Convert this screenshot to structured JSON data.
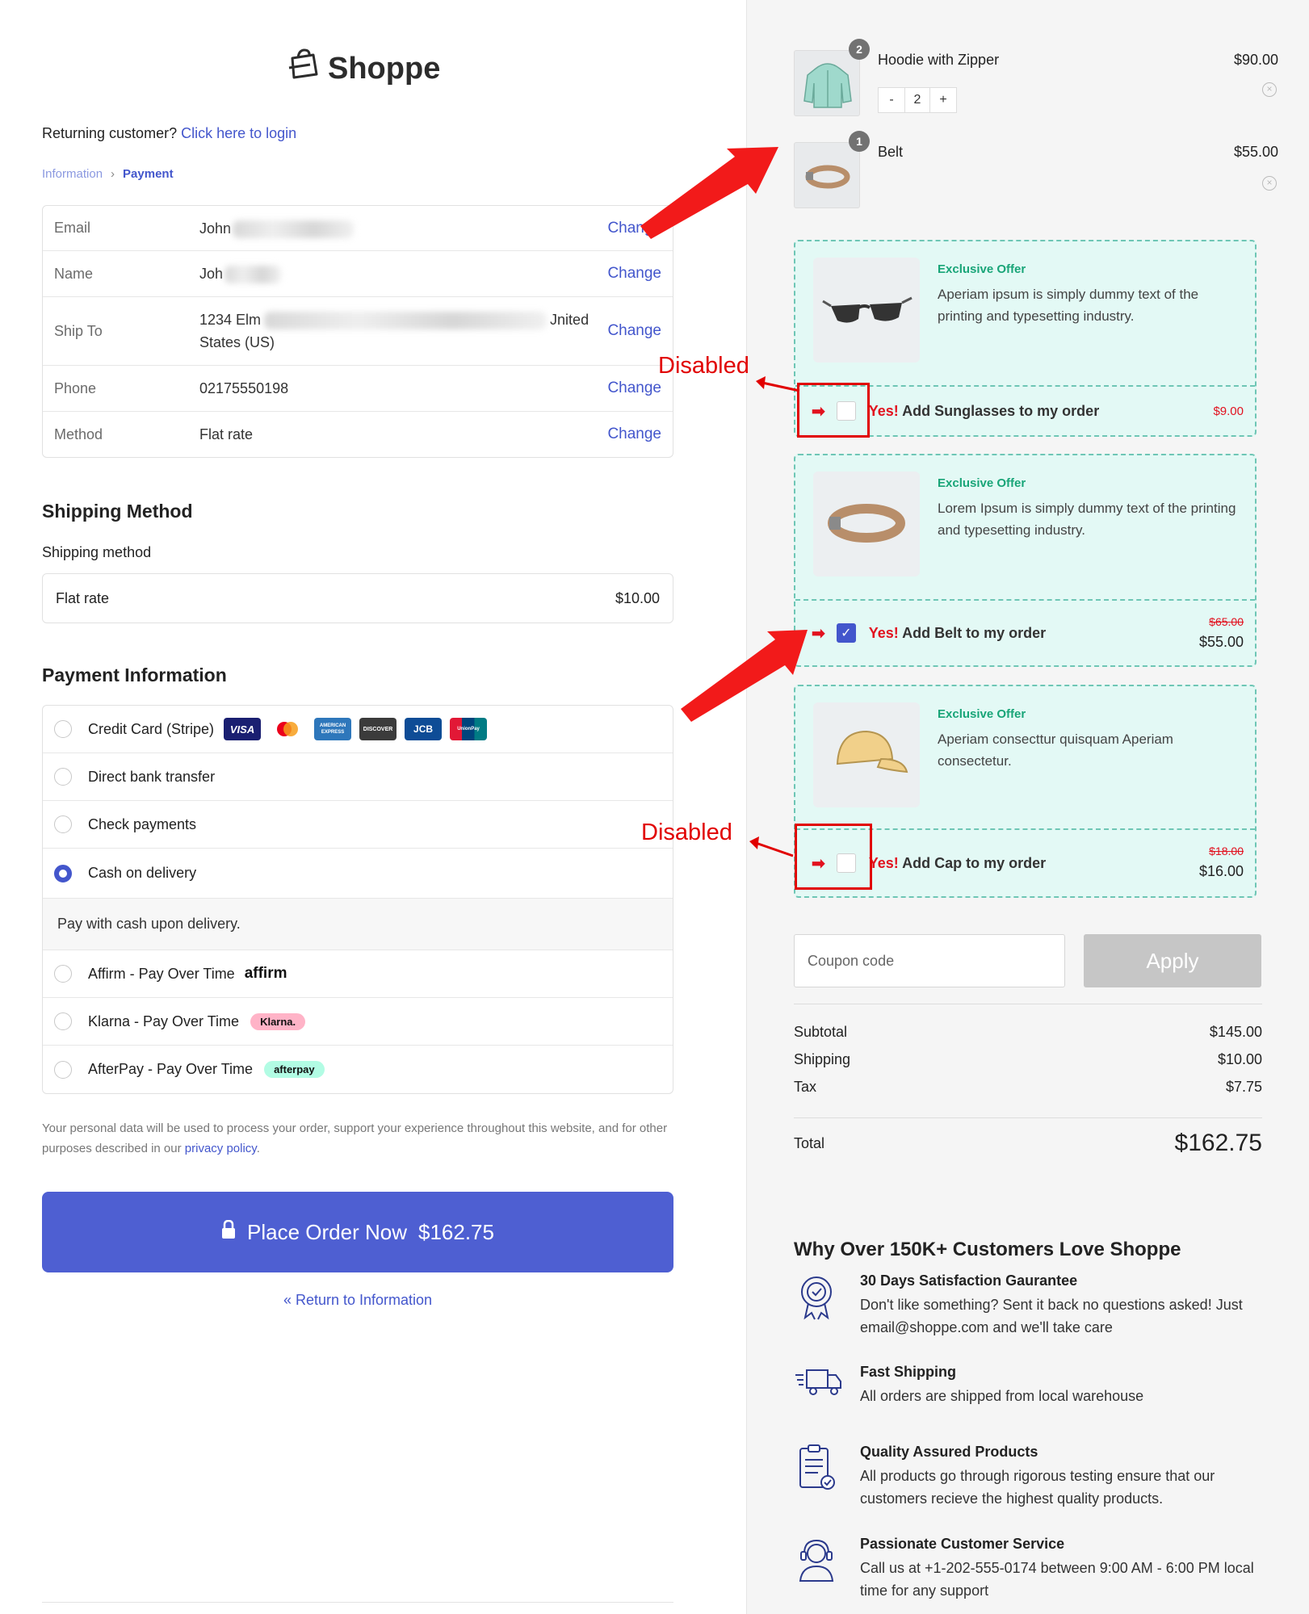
{
  "brand": {
    "name": "Shoppe"
  },
  "returning": {
    "text": "Returning customer?",
    "link": "Click here to login"
  },
  "breadcrumb": {
    "step1": "Information",
    "step2": "Payment"
  },
  "info": {
    "rows": [
      {
        "label": "Email",
        "value": "John",
        "change": "Change"
      },
      {
        "label": "Name",
        "value": "Joh",
        "change": "Change"
      },
      {
        "label": "Ship To",
        "value": "1234 Elm",
        "value_tail": "Jnited",
        "value2": "States (US)",
        "change": "Change"
      },
      {
        "label": "Phone",
        "value": "02175550198",
        "change": "Change"
      },
      {
        "label": "Method",
        "value": "Flat rate",
        "change": "Change"
      }
    ]
  },
  "shipping": {
    "title": "Shipping Method",
    "label": "Shipping method",
    "option": "Flat rate",
    "price": "$10.00"
  },
  "payment": {
    "title": "Payment Information",
    "methods": [
      "Credit Card (Stripe)",
      "Direct bank transfer",
      "Check payments",
      "Cash on delivery",
      "Affirm - Pay Over Time",
      "Klarna - Pay Over Time",
      "AfterPay - Pay Over Time"
    ],
    "selected": "Cash on delivery",
    "note": "Pay with cash upon delivery.",
    "cards": [
      "VISA",
      "mastercard",
      "AMERICAN EXPRESS",
      "DISCOVER",
      "JCB",
      "UnionPay"
    ],
    "badges": {
      "affirm": "affirm",
      "klarna": "Klarna.",
      "afterpay": "afterpay"
    }
  },
  "legal": {
    "text": "Your personal data will be used to process your order, support your experience throughout this website, and for other purposes described in our",
    "link": "privacy policy",
    "end": "."
  },
  "place_order": {
    "label": "Place Order Now",
    "amount": "$162.75"
  },
  "return_link": "« Return to Information",
  "cart": {
    "items": [
      {
        "name": "Hoodie with Zipper",
        "price": "$90.00",
        "qty": "2"
      },
      {
        "name": "Belt",
        "price": "$55.00",
        "qty": "1"
      }
    ],
    "stepper": {
      "minus": "-",
      "value": "2",
      "plus": "+"
    }
  },
  "offers": [
    {
      "tag": "Exclusive Offer",
      "desc": "Aperiam ipsum is simply dummy text of the printing and typesetting industry.",
      "yes": "Yes!",
      "text": "Add Sunglasses to my order",
      "price": "$9.00",
      "old_price": "",
      "checked": false
    },
    {
      "tag": "Exclusive Offer",
      "desc": "Lorem Ipsum is simply dummy text of the printing and typesetting industry.",
      "yes": "Yes!",
      "text": "Add Belt to my order",
      "old_price": "$65.00",
      "price": "$55.00",
      "checked": true
    },
    {
      "tag": "Exclusive Offer",
      "desc": "Aperiam consecttur quisquam Aperiam consectetur.",
      "yes": "Yes!",
      "text": "Add Cap to my order",
      "old_price": "$18.00",
      "price": "$16.00",
      "checked": false
    }
  ],
  "annotations": {
    "disabled": "Disabled"
  },
  "coupon": {
    "placeholder": "Coupon code",
    "apply": "Apply"
  },
  "summary": {
    "subtotal_label": "Subtotal",
    "subtotal": "$145.00",
    "shipping_label": "Shipping",
    "shipping": "$10.00",
    "tax_label": "Tax",
    "tax": "$7.75",
    "total_label": "Total",
    "total": "$162.75"
  },
  "why": {
    "title": "Why Over 150K+ Customers Love Shoppe",
    "features": [
      {
        "title": "30 Days Satisfaction Gaurantee",
        "desc": "Don't like something? Sent it back no questions asked! Just email@shoppe.com and we'll take care",
        "icon": "badge-icon"
      },
      {
        "title": "Fast Shipping",
        "desc": "All orders are shipped from local warehouse",
        "icon": "truck-icon"
      },
      {
        "title": "Quality Assured Products",
        "desc": "All products go through rigorous testing ensure that our customers recieve the highest quality products.",
        "icon": "clipboard-icon"
      },
      {
        "title": "Passionate Customer Service",
        "desc": "Call us at +1-202-555-0174 between 9:00 AM - 6:00 PM local time for any support",
        "icon": "headset-icon"
      }
    ]
  },
  "colors": {
    "accent": "#4e5fd2",
    "link": "#4356cc",
    "offer_bg": "#e3f9f5",
    "offer_border": "#6ec6b5",
    "annotation_red": "#e10000"
  }
}
